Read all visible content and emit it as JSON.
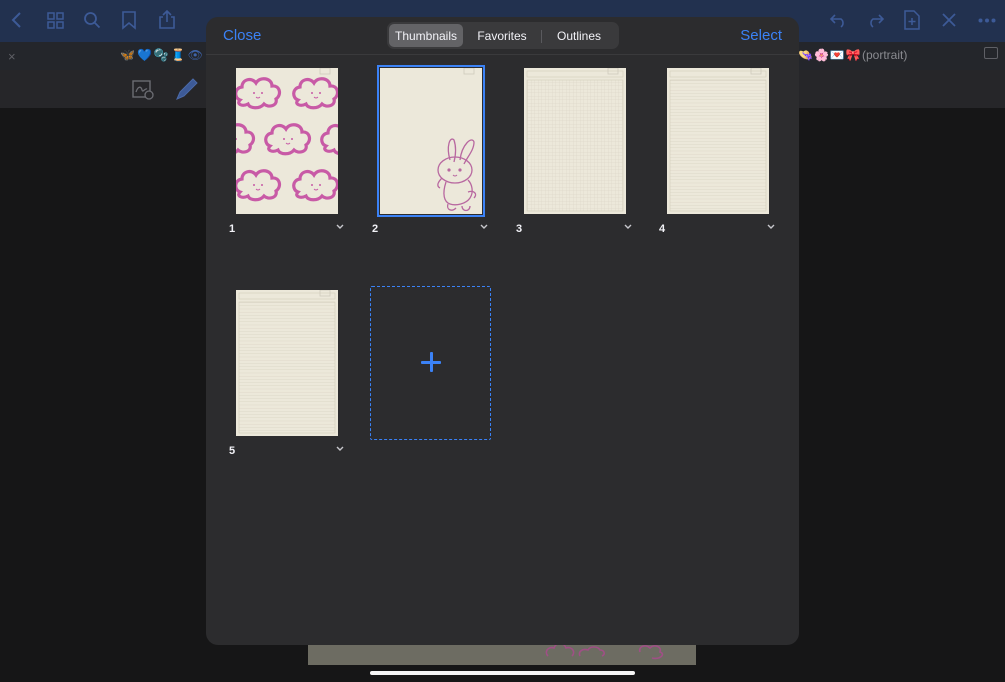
{
  "background": {
    "title_fragment": "(portrait)",
    "tab_title": "(portrait)",
    "tab_emoji_left": "🦋💙🫧🧵👁📗",
    "tab_emoji_right": "👒🌸💌🎀",
    "tab_close": "×"
  },
  "modal": {
    "close_label": "Close",
    "select_label": "Select",
    "tabs": [
      {
        "label": "Thumbnails",
        "active": true
      },
      {
        "label": "Favorites",
        "active": false
      },
      {
        "label": "Outlines",
        "active": false
      }
    ],
    "pages": [
      {
        "number": "1",
        "template": "clouds",
        "selected": false
      },
      {
        "number": "2",
        "template": "bunny",
        "selected": true
      },
      {
        "number": "3",
        "template": "grid",
        "selected": false
      },
      {
        "number": "4",
        "template": "lined",
        "selected": false
      },
      {
        "number": "5",
        "template": "lined",
        "selected": false
      }
    ]
  },
  "colors": {
    "accent": "#3b82f6",
    "modal_bg": "#2c2c2e",
    "paper": "#ece8da",
    "cloud_pink": "#c85aa6"
  }
}
